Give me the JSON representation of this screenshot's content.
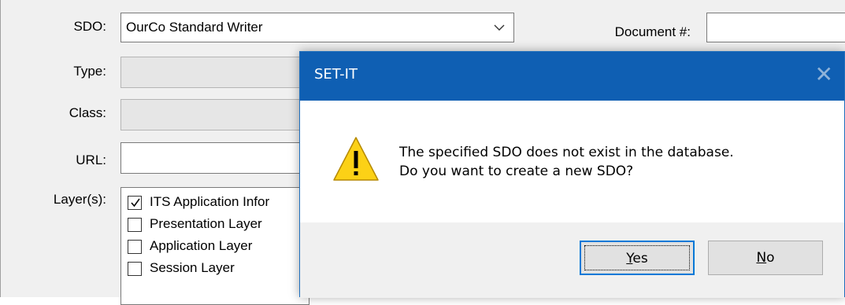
{
  "form": {
    "sdo_label": "SDO:",
    "sdo_value": "OurCo Standard Writer",
    "document_label": "Document #:",
    "document_value": "",
    "type_label": "Type:",
    "class_label": "Class:",
    "url_label": "URL:",
    "layers_label": "Layer(s):",
    "layers": [
      {
        "label": "ITS Application Infor",
        "checked": true
      },
      {
        "label": "Presentation Layer",
        "checked": false
      },
      {
        "label": "Application Layer",
        "checked": false
      },
      {
        "label": "Session Layer",
        "checked": false
      }
    ]
  },
  "dialog": {
    "title": "SET-IT",
    "close_glyph": "✕",
    "message_line1": "The specified SDO does not exist in the database.",
    "message_line2": "Do you want to create a new SDO?",
    "yes_first": "Y",
    "yes_rest": "es",
    "no_first": "N",
    "no_rest": "o",
    "icon": "warning-icon"
  },
  "colors": {
    "titlebar": "#0f5fb3",
    "warning": "#fcd116",
    "focus_border": "#0078d7"
  }
}
